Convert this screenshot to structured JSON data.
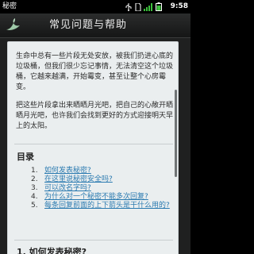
{
  "status_bar": {
    "app_name": "秘密",
    "time": "9:58",
    "icons": [
      "usb-icon",
      "sim-icon",
      "signal-icon",
      "battery-icon"
    ]
  },
  "header": {
    "title": "常见问题与帮助"
  },
  "content": {
    "intro_paragraph_1": "生命中总有一些片段无处安放，被我们扔进心底的垃圾桶，但我们很少忘记事情，无法清空这个垃圾桶，它越来越满，开始霉变，甚至让整个心房霉变。",
    "intro_paragraph_2": "把这些片段拿出来晒晒月光吧，把自己的心敞开晒晒月光吧，也许我们会找到更好的方式迎接明天早上的太阳。",
    "toc_heading": "目录",
    "toc_items": [
      {
        "num": "1.",
        "text": "如何发表秘密?"
      },
      {
        "num": "2.",
        "text": "在这里说秘密安全吗?"
      },
      {
        "num": "3.",
        "text": "可以改名字吗?"
      },
      {
        "num": "4.",
        "text": "为什么对一个秘密不能多次回复?"
      },
      {
        "num": "5.",
        "text": "每条回复前面的上下箭头是干什么用的?"
      }
    ],
    "section_1_heading": "1. 如何发表秘密?"
  }
}
